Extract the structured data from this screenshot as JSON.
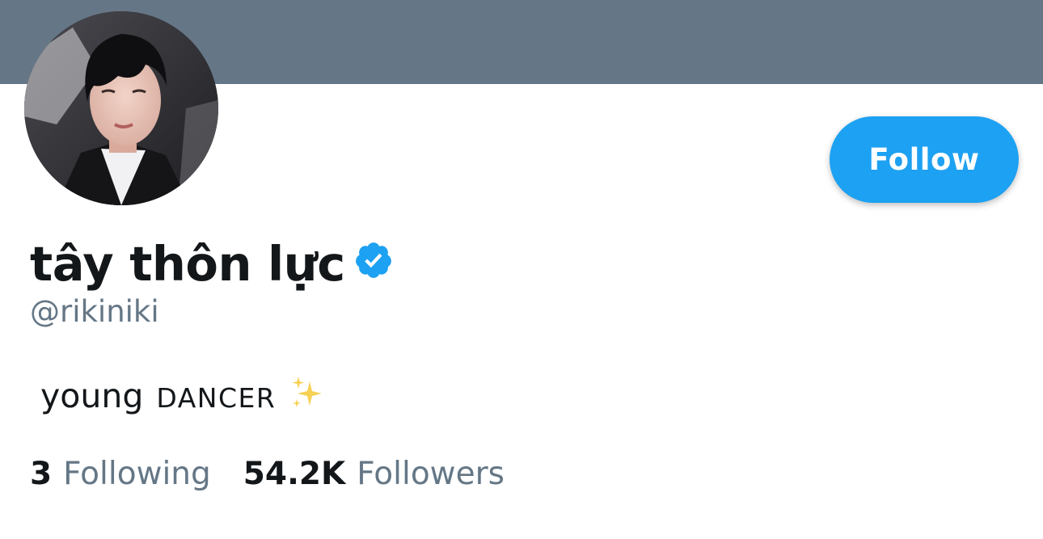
{
  "header": {
    "banner_color": "#657786"
  },
  "avatar": {
    "icon": "profile-photo"
  },
  "actions": {
    "follow_label": "Follow",
    "accent_color": "#1da1f2"
  },
  "profile": {
    "display_name": "tây thôn lực",
    "verified_icon": "verified-badge-icon",
    "handle": "@rikiniki",
    "bio_lower": "young",
    "bio_caps": "DANCER",
    "bio_emoji": "sparkles-icon"
  },
  "stats": {
    "following_count": "3",
    "following_label": "Following",
    "followers_count": "54.2K",
    "followers_label": "Followers"
  }
}
